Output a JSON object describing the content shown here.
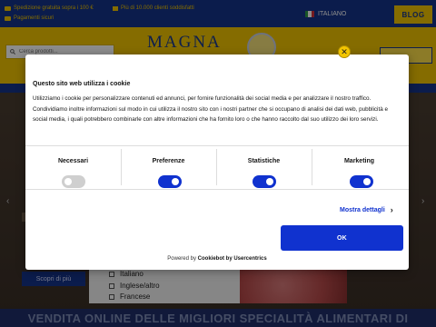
{
  "topbar": {
    "promo1": "Spedizione gratuita sopra i 100 €",
    "promo2": "Pagamenti sicuri",
    "promo3": "Più di 10.000 clienti soddisfatti",
    "language": "ITALIANO",
    "blog_label": "BLOG"
  },
  "header": {
    "search_placeholder": "Cerca prodotti...",
    "brand": "MAGNA"
  },
  "hero": {
    "discover_label": "Scopri di più",
    "languages": [
      "Italiano",
      "Inglese/altro",
      "Francese"
    ]
  },
  "bottom_banner": "VENDITA ONLINE DELLE MIGLIORI SPECIALITÀ ALIMENTARI DI",
  "cookie": {
    "close_label": "✕",
    "title": "Questo sito web utilizza i cookie",
    "body": "Utilizziamo i cookie per personalizzare contenuti ed annunci, per fornire funzionalità dei social media e per analizzare il nostro traffico. Condividiamo inoltre informazioni sul modo in cui utilizza il nostro sito con i nostri partner che si occupano di analisi dei dati web, pubblicità e social media, i quali potrebbero combinarle con altre informazioni che ha fornito loro o che hanno raccolto dal suo utilizzo dei loro servizi.",
    "categories": [
      {
        "label": "Necessari",
        "state": "disabled"
      },
      {
        "label": "Preferenze",
        "state": "on"
      },
      {
        "label": "Statistiche",
        "state": "on"
      },
      {
        "label": "Marketing",
        "state": "on"
      }
    ],
    "details_label": "Mostra dettagli",
    "ok_label": "OK",
    "powered_prefix": "Powered by",
    "powered_brand": "Cookiebot by Usercentrics"
  },
  "colors": {
    "navy": "#15348a",
    "gold": "#f3c500",
    "accent_blue": "#1032cf"
  }
}
